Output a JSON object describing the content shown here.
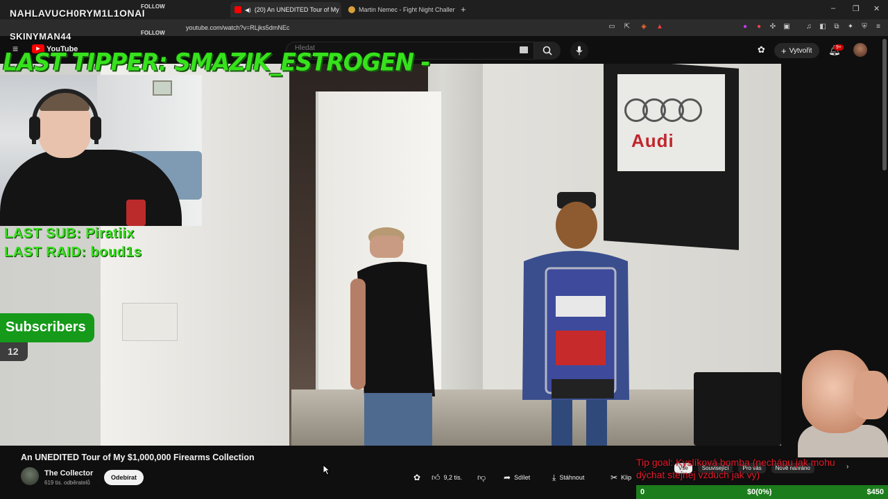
{
  "browser": {
    "tabs": [
      {
        "title": "(20) An UNEDITED Tour of My",
        "active": true
      },
      {
        "title": "Martin Nemec - Fight Night Challeng",
        "active": false
      }
    ],
    "url": "youtube.com/watch?v=RLjks5dmNEc"
  },
  "youtube": {
    "logo": "YouTube",
    "search_placeholder": "Hledat",
    "create_label": "Vytvořit",
    "notif_count": "9+"
  },
  "overlay": {
    "follows": [
      {
        "name": "NAHLAVUCH0RYM1L1ONAI",
        "tag": "FOLLOW"
      },
      {
        "name": "SKINYMAN44",
        "tag": "FOLLOW"
      }
    ],
    "last_tipper": "LAST TIPPER: SMAZIK_ESTROGEN -",
    "last_sub": "LAST SUB: Piratiix",
    "last_raid": "LAST RAID: boud1s",
    "subscribers_label": "Subscribers",
    "subscribers_count": "12",
    "tip_goal": {
      "text": "Tip goal: Kyslíková bomba (nechápu jak mohu dýchat stejnej vzduch jak vy)",
      "current": "0",
      "status": "$0(0%)",
      "target": "$450",
      "progress": 0
    }
  },
  "video": {
    "title": "An UNEDITED Tour of My $1,000,000 Firearms Collection",
    "scene_text": "Audi",
    "channel": "The Collector",
    "subscribers": "619 tis. odběratelů",
    "subscribe_label": "Odebírat",
    "likes": "9,2 tis.",
    "share_label": "Sdílet",
    "download_label": "Stáhnout",
    "clip_label": "Klip"
  },
  "sidebar_chips": [
    "Vše",
    "Související",
    "Pro vás",
    "Nově nahráno"
  ],
  "colors": {
    "overlay_green": "#37e21d",
    "tip_red": "#e51a2a",
    "yt_red": "#ff0000",
    "bg": "#0f0f0f"
  }
}
